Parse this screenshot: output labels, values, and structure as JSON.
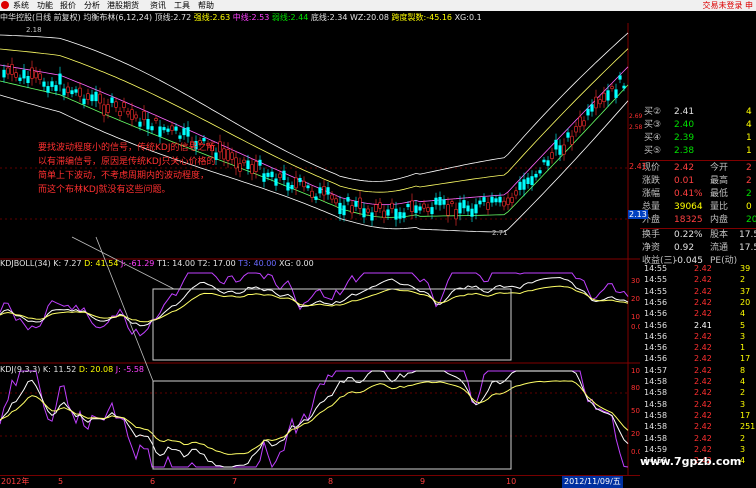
{
  "menubar": {
    "items": [
      "系统",
      "功能",
      "报价",
      "分析",
      "港股期货",
      "资讯",
      "工具",
      "帮助"
    ],
    "login": "交易未登录",
    "extra": "申"
  },
  "indicator_line": {
    "title": "中华控股(日线 前复权) 均衡布林(6,12,24)",
    "items": [
      {
        "label": "顶线:",
        "value": "2.72"
      },
      {
        "label": "强线:",
        "value": "2.63"
      },
      {
        "label": "中线:",
        "value": "2.53"
      },
      {
        "label": "弱线:",
        "value": "2.44"
      },
      {
        "label": "底线:",
        "value": "2.34"
      },
      {
        "label": "WZ:",
        "value": "20.08"
      },
      {
        "label": "跨度製数:",
        "value": "-45.16"
      },
      {
        "label": "XG:",
        "value": "0.1"
      }
    ]
  },
  "price_labels": {
    "top": "2.18",
    "low": "2.71"
  },
  "annotation": "要找波动程度小的信号，传统KDJ的信号之所以有滞编信号，原因是传统KDJ只关心价格的简单上下波动，不考虑周期内的波动程度，而这个布林KDJ就没有这些问题。",
  "kdjboll": {
    "name": "KDJBOLL(34)",
    "k": "K: 7.27",
    "d": "D: 41.54",
    "j": "J: -61.29",
    "t1": "T1: 14.00",
    "t2": "T2: 17.00",
    "t3": "T3: 40.00",
    "xg": "XG: 0.00",
    "axis": [
      "300",
      "200",
      "100",
      "0.00"
    ]
  },
  "kdj": {
    "name": "KDJ(9,3,3)",
    "k": "K: 11.52",
    "d": "D: 20.08",
    "j": "J: -5.58",
    "axis": [
      "100.00",
      "80.00",
      "50.00",
      "20.00",
      "0.00"
    ]
  },
  "quote": {
    "buy": [
      {
        "label": "买②",
        "price": "2.41",
        "vol": "4"
      },
      {
        "label": "买③",
        "price": "2.40",
        "vol": "4"
      },
      {
        "label": "买④",
        "price": "2.39",
        "vol": "1"
      },
      {
        "label": "买⑤",
        "price": "2.38",
        "vol": "1"
      }
    ],
    "stats": [
      {
        "l1": "现价",
        "v1": "2.42",
        "l2": "今开",
        "v2": "2"
      },
      {
        "l1": "涨跌",
        "v1": "0.01",
        "l2": "最高",
        "v2": "2"
      },
      {
        "l1": "涨幅",
        "v1": "0.41%",
        "l2": "最低",
        "v2": "2"
      },
      {
        "l1": "总量",
        "v1": "39064",
        "l2": "量比",
        "v2": "0"
      },
      {
        "l1": "外盘",
        "v1": "18325",
        "l2": "内盘",
        "v2": "20"
      }
    ],
    "stats2": [
      {
        "l1": "换手",
        "v1": "0.22%",
        "l2": "股本",
        "v2": "17.5"
      },
      {
        "l1": "净资",
        "v1": "0.92",
        "l2": "流通",
        "v2": "17.5"
      },
      {
        "l1": "收益(三)",
        "v1": "-0.045",
        "l2": "PE(动)",
        "v2": ""
      }
    ],
    "side_price": "2.13",
    "side_price2": "2.41",
    "small_prices": [
      "2.69",
      "2.58"
    ]
  },
  "ticks": [
    {
      "time": "14:55",
      "price": "2.42",
      "vol": "39"
    },
    {
      "time": "14:55",
      "price": "2.42",
      "vol": "2"
    },
    {
      "time": "14:55",
      "price": "2.42",
      "vol": "37"
    },
    {
      "time": "14:56",
      "price": "2.42",
      "vol": "20"
    },
    {
      "time": "14:56",
      "price": "2.42",
      "vol": "4"
    },
    {
      "time": "14:56",
      "price": "2.41",
      "vol": "5"
    },
    {
      "time": "14:56",
      "price": "2.42",
      "vol": "3"
    },
    {
      "time": "14:56",
      "price": "2.42",
      "vol": "1"
    },
    {
      "time": "14:56",
      "price": "2.42",
      "vol": "17"
    },
    {
      "time": "14:57",
      "price": "2.42",
      "vol": "8"
    },
    {
      "time": "14:58",
      "price": "2.42",
      "vol": "4"
    },
    {
      "time": "14:58",
      "price": "2.42",
      "vol": "2"
    },
    {
      "time": "14:58",
      "price": "2.42",
      "vol": "3"
    },
    {
      "time": "14:58",
      "price": "2.42",
      "vol": "17"
    },
    {
      "time": "14:58",
      "price": "2.42",
      "vol": "251"
    },
    {
      "time": "14:58",
      "price": "2.42",
      "vol": "2"
    },
    {
      "time": "14:59",
      "price": "2.42",
      "vol": "3"
    },
    {
      "time": "14:59",
      "price": "2.42",
      "vol": "4"
    }
  ],
  "axis_bottom": {
    "labels": [
      "2012年",
      "5",
      "6",
      "7",
      "8",
      "9",
      "10",
      "2012/11/09/五"
    ]
  },
  "watermark": "www.7gpzb.com",
  "colors": {
    "up": "#ff3030",
    "down": "#00ffff",
    "k_line": "#ffffff",
    "d_line": "#ffff00",
    "j_line": "#c040ff"
  }
}
